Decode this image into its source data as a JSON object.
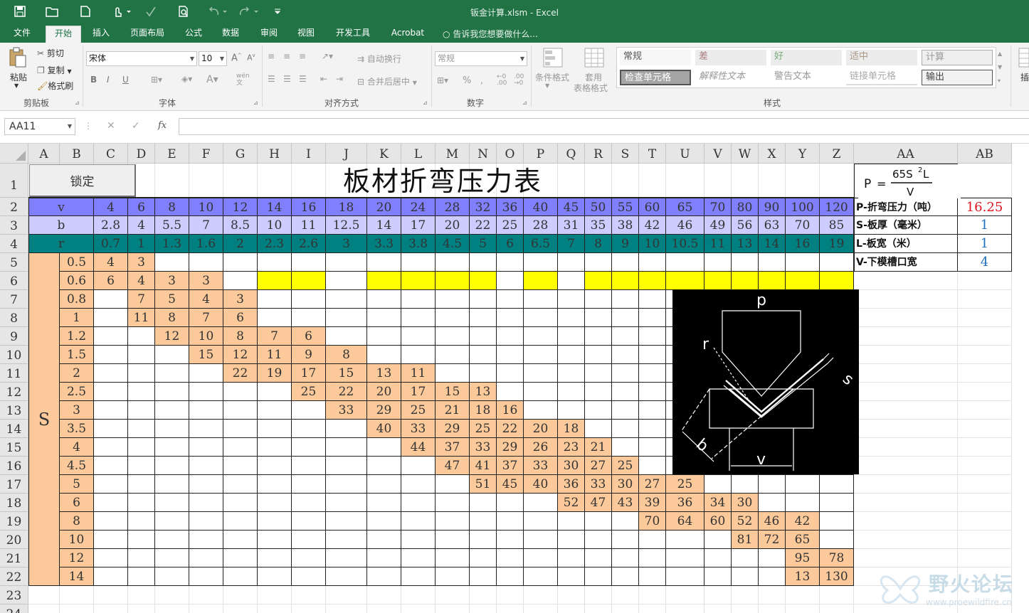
{
  "window": {
    "title": "钣金计算.xlsm - Excel"
  },
  "tabs": [
    {
      "label": "文件",
      "active": false
    },
    {
      "label": "开始",
      "active": true
    },
    {
      "label": "插入",
      "active": false
    },
    {
      "label": "页面布局",
      "active": false
    },
    {
      "label": "公式",
      "active": false
    },
    {
      "label": "数据",
      "active": false
    },
    {
      "label": "审阅",
      "active": false
    },
    {
      "label": "视图",
      "active": false
    },
    {
      "label": "开发工具",
      "active": false
    },
    {
      "label": "Acrobat",
      "active": false
    }
  ],
  "tell_me": "告诉我您想要做什么...",
  "ribbon": {
    "clipboard": {
      "paste": "粘贴",
      "cut": "剪切",
      "copy": "复制",
      "format_painter": "格式刷",
      "group": "剪贴板"
    },
    "font": {
      "name": "宋体",
      "size": "10",
      "bold": "B",
      "italic": "I",
      "underline": "U",
      "group": "字体"
    },
    "alignment": {
      "wrap": "自动换行",
      "merge": "合并后居中",
      "group": "对齐方式"
    },
    "number": {
      "format": "常规",
      "group": "数字"
    },
    "styles": {
      "conditional": "条件格式",
      "table1": "套用",
      "table2": "表格格式",
      "group": "样式",
      "gallery": [
        "常规",
        "差",
        "好",
        "适中",
        "计算",
        "检查单元格",
        "解释性文本",
        "警告文本",
        "链接单元格",
        "输出"
      ]
    },
    "insert_partial": "插"
  },
  "formula_bar": {
    "name_box": "AA11",
    "fx": "fx",
    "content": ""
  },
  "columns": [
    "A",
    "B",
    "C",
    "D",
    "E",
    "F",
    "G",
    "H",
    "I",
    "J",
    "K",
    "L",
    "M",
    "N",
    "O",
    "P",
    "Q",
    "R",
    "S",
    "T",
    "U",
    "V",
    "W",
    "X",
    "Y",
    "Z",
    "AA",
    "AB"
  ],
  "rows": [
    "1",
    "2",
    "3",
    "4",
    "5",
    "6",
    "7",
    "8",
    "9",
    "10",
    "11",
    "12",
    "13",
    "14",
    "15",
    "16",
    "17",
    "18",
    "19",
    "20",
    "21",
    "22",
    "23",
    "24"
  ],
  "sheet": {
    "lock_button": "锁定",
    "title": "板材折弯压力表",
    "v_label": "v",
    "b_label": "b",
    "r_label": "r",
    "s_label": "S",
    "v_values": [
      "4",
      "6",
      "8",
      "10",
      "12",
      "14",
      "16",
      "18",
      "20",
      "24",
      "28",
      "32",
      "36",
      "40",
      "45",
      "50",
      "55",
      "60",
      "65",
      "70",
      "80",
      "90",
      "100",
      "120"
    ],
    "b_values": [
      "2.8",
      "4",
      "5.5",
      "7",
      "8.5",
      "10",
      "11",
      "12.5",
      "14",
      "17",
      "20",
      "22",
      "25",
      "28",
      "31",
      "35",
      "38",
      "42",
      "46",
      "49",
      "56",
      "63",
      "70",
      "85"
    ],
    "r_values": [
      "0.7",
      "1",
      "1.3",
      "1.6",
      "2",
      "2.3",
      "2.6",
      "3",
      "3.3",
      "3.8",
      "4.5",
      "5",
      "6",
      "6.5",
      "7",
      "8",
      "9",
      "10",
      "10.5",
      "11",
      "13",
      "14",
      "16",
      "19"
    ],
    "s_values": [
      "0.5",
      "0.6",
      "0.8",
      "1",
      "1.2",
      "1.5",
      "2",
      "2.5",
      "3",
      "3.5",
      "4",
      "4.5",
      "5",
      "6",
      "8",
      "10",
      "12",
      "14"
    ],
    "table": [
      [
        "4",
        "3",
        "",
        "",
        "",
        "",
        "",
        "",
        "",
        "",
        "",
        "",
        "",
        "",
        "",
        "",
        "",
        "",
        "",
        "",
        "",
        "",
        "",
        ""
      ],
      [
        "6",
        "4",
        "3",
        "3",
        "",
        "",
        "",
        "",
        "",
        "",
        "",
        "",
        "",
        "",
        "",
        "",
        "",
        "",
        "",
        "",
        "",
        "",
        "",
        ""
      ],
      [
        "",
        "7",
        "5",
        "4",
        "3",
        "",
        "",
        "",
        "",
        "",
        "",
        "",
        "",
        "",
        "",
        "",
        "",
        "",
        "",
        "",
        "",
        "",
        "",
        ""
      ],
      [
        "",
        "11",
        "8",
        "7",
        "6",
        "",
        "",
        "",
        "",
        "",
        "",
        "",
        "",
        "",
        "",
        "",
        "",
        "",
        "",
        "",
        "",
        "",
        "",
        ""
      ],
      [
        "",
        "",
        "12",
        "10",
        "8",
        "7",
        "6",
        "",
        "",
        "",
        "",
        "",
        "",
        "",
        "",
        "",
        "",
        "",
        "",
        "",
        "",
        "",
        "",
        ""
      ],
      [
        "",
        "",
        "",
        "15",
        "12",
        "11",
        "9",
        "8",
        "",
        "",
        "",
        "",
        "",
        "",
        "",
        "",
        "",
        "",
        "",
        "",
        "",
        "",
        "",
        ""
      ],
      [
        "",
        "",
        "",
        "",
        "22",
        "19",
        "17",
        "15",
        "13",
        "11",
        "",
        "",
        "",
        "",
        "",
        "",
        "",
        "",
        "",
        "",
        "",
        "",
        "",
        ""
      ],
      [
        "",
        "",
        "",
        "",
        "",
        "",
        "25",
        "22",
        "20",
        "17",
        "15",
        "13",
        "",
        "",
        "",
        "",
        "",
        "",
        "",
        "",
        "",
        "",
        "",
        ""
      ],
      [
        "",
        "",
        "",
        "",
        "",
        "",
        "",
        "33",
        "29",
        "25",
        "21",
        "18",
        "16",
        "",
        "",
        "",
        "",
        "",
        "",
        "",
        "",
        "",
        "",
        ""
      ],
      [
        "",
        "",
        "",
        "",
        "",
        "",
        "",
        "",
        "40",
        "33",
        "29",
        "25",
        "22",
        "20",
        "18",
        "",
        "",
        "",
        "",
        "",
        "",
        "",
        "",
        ""
      ],
      [
        "",
        "",
        "",
        "",
        "",
        "",
        "",
        "",
        "",
        "44",
        "37",
        "33",
        "29",
        "26",
        "23",
        "21",
        "",
        "",
        "",
        "",
        "",
        "",
        "",
        ""
      ],
      [
        "",
        "",
        "",
        "",
        "",
        "",
        "",
        "",
        "",
        "",
        "47",
        "41",
        "37",
        "33",
        "30",
        "27",
        "25",
        "",
        "",
        "",
        "",
        "",
        "",
        ""
      ],
      [
        "",
        "",
        "",
        "",
        "",
        "",
        "",
        "",
        "",
        "",
        "",
        "51",
        "45",
        "40",
        "36",
        "33",
        "30",
        "27",
        "25",
        "",
        "",
        "",
        "",
        ""
      ],
      [
        "",
        "",
        "",
        "",
        "",
        "",
        "",
        "",
        "",
        "",
        "",
        "",
        "",
        "",
        "52",
        "47",
        "43",
        "39",
        "36",
        "34",
        "30",
        "",
        "",
        ""
      ],
      [
        "",
        "",
        "",
        "",
        "",
        "",
        "",
        "",
        "",
        "",
        "",
        "",
        "",
        "",
        "",
        "",
        "",
        "70",
        "64",
        "60",
        "52",
        "46",
        "42",
        ""
      ],
      [
        "",
        "",
        "",
        "",
        "",
        "",
        "",
        "",
        "",
        "",
        "",
        "",
        "",
        "",
        "",
        "",
        "",
        "",
        "",
        "",
        "81",
        "72",
        "65",
        ""
      ],
      [
        "",
        "",
        "",
        "",
        "",
        "",
        "",
        "",
        "",
        "",
        "",
        "",
        "",
        "",
        "",
        "",
        "",
        "",
        "",
        "",
        "",
        "",
        "95",
        "78"
      ],
      [
        "",
        "",
        "",
        "",
        "",
        "",
        "",
        "",
        "",
        "",
        "",
        "",
        "",
        "",
        "",
        "",
        "",
        "",
        "",
        "",
        "",
        "",
        "13",
        "130"
      ]
    ],
    "yellow_cols": [
      5,
      6,
      8,
      9,
      10,
      11,
      13,
      15,
      16,
      17,
      18,
      19,
      20,
      21,
      22,
      23
    ],
    "legend": [
      {
        "label": "P-折弯压力（吨）",
        "value": "16.25",
        "color": "#e0141e"
      },
      {
        "label": "S-板厚（毫米）",
        "value": "1",
        "color": "#1f6fc0"
      },
      {
        "label": "L-板宽（米）",
        "value": "1",
        "color": "#1f6fc0"
      },
      {
        "label": "V-下模槽口宽",
        "value": "4",
        "color": "#1f6fc0"
      }
    ],
    "formula": {
      "p": "P",
      "eq": "=",
      "numerator": "65S",
      "sup": "2",
      "L": "L",
      "den": "V"
    },
    "diagram": {
      "p": "p",
      "r": "r",
      "s": "s",
      "b": "b",
      "v": "v"
    }
  },
  "watermark": {
    "text": "野火论坛",
    "url": "www.proewildfire.cn"
  },
  "colors": {
    "excel_green": "#217346",
    "v_header": "#8080ff",
    "b_header": "#ccccff",
    "r_header": "#008080",
    "value_cell": "#fcc99b",
    "yellow": "#ffff00"
  }
}
